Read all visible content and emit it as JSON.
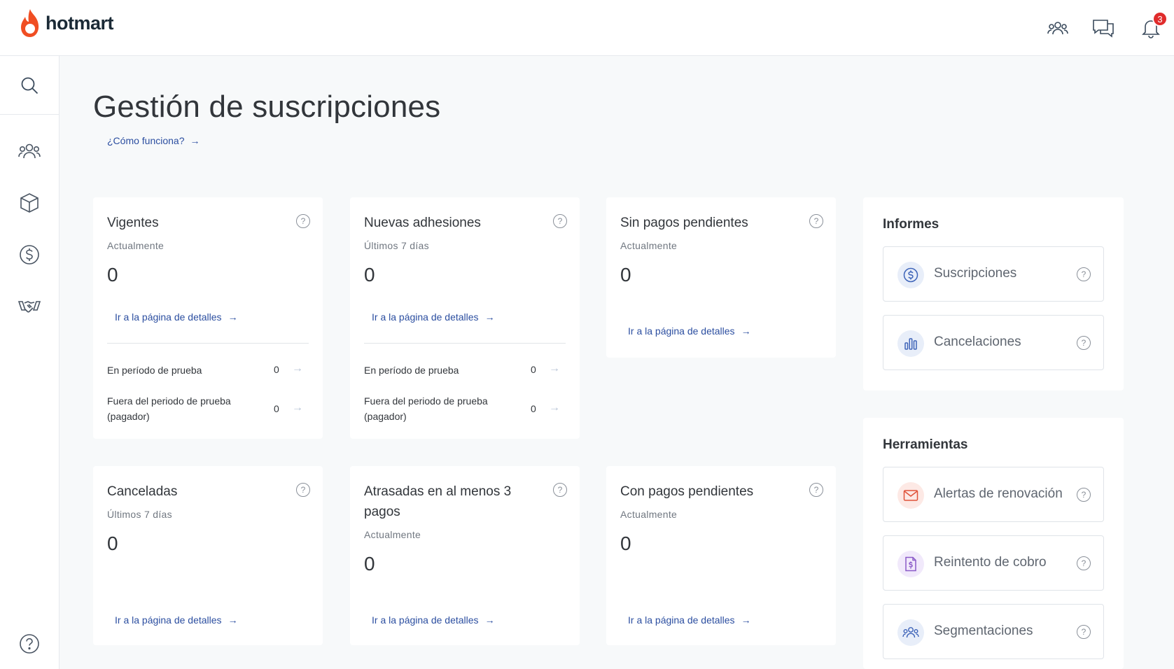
{
  "header": {
    "logo_text": "hotmart",
    "notification_count": "3",
    "icons": [
      "people-icon",
      "chat-icon",
      "bell-icon"
    ]
  },
  "sidebar": {
    "icons": [
      "search-icon",
      "people-icon",
      "box-icon",
      "dollar-icon",
      "handshake-icon",
      "help-icon"
    ]
  },
  "page": {
    "title": "Gestión de suscripciones",
    "how_link": "¿Cómo funciona?"
  },
  "cards": [
    {
      "title": "Vigentes",
      "subtitle": "Actualmente",
      "value": "0",
      "link": "Ir a la página de detalles",
      "rows": [
        {
          "label": "En período de prueba",
          "value": "0"
        },
        {
          "label": "Fuera del periodo de prueba (pagador)",
          "value": "0"
        }
      ]
    },
    {
      "title": "Nuevas adhesiones",
      "subtitle": "Últimos 7 días",
      "value": "0",
      "link": "Ir a la página de detalles",
      "rows": [
        {
          "label": "En período de prueba",
          "value": "0"
        },
        {
          "label": "Fuera del periodo de prueba (pagador)",
          "value": "0"
        }
      ]
    },
    {
      "title": "Sin pagos pendientes",
      "subtitle": "Actualmente",
      "value": "0",
      "link": "Ir a la página de detalles"
    },
    {
      "title": "Canceladas",
      "subtitle": "Últimos 7 días",
      "value": "0",
      "link": "Ir a la página de detalles"
    },
    {
      "title": "Atrasadas en al menos 3 pagos",
      "subtitle": "Actualmente",
      "value": "0",
      "link": "Ir a la página de detalles"
    },
    {
      "title": "Con pagos pendientes",
      "subtitle": "Actualmente",
      "value": "0",
      "link": "Ir a la página de detalles"
    }
  ],
  "reports": {
    "title": "Informes",
    "items": [
      {
        "label": "Suscripciones",
        "icon": "dollar-circle-icon"
      },
      {
        "label": "Cancelaciones",
        "icon": "bar-chart-icon"
      }
    ]
  },
  "tools": {
    "title": "Herramientas",
    "items": [
      {
        "label": "Alertas de renovación",
        "icon": "envelope-icon"
      },
      {
        "label": "Reintento de cobro",
        "icon": "invoice-icon"
      },
      {
        "label": "Segmentaciones",
        "icon": "people-icon"
      }
    ]
  },
  "colors": {
    "brand": "#f04e23",
    "link": "#2b4ea0",
    "badge": "#e02c2c"
  }
}
